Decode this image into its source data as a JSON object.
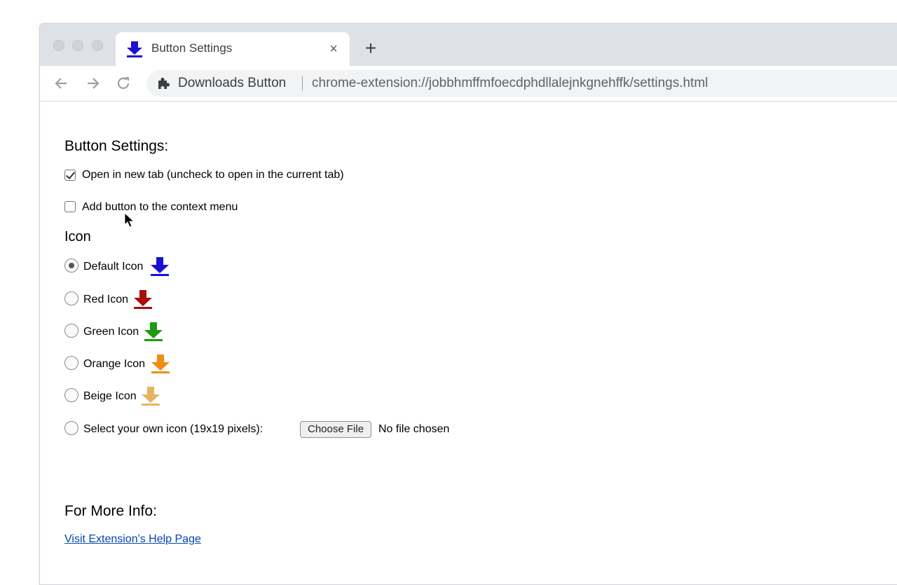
{
  "browser": {
    "tab": {
      "title": "Button Settings",
      "close_glyph": "×",
      "favicon": "download-arrow-icon"
    },
    "new_tab_glyph": "+",
    "omnibox": {
      "site_name": "Downloads Button",
      "url": "chrome-extension://jobbhmffmfoecdphdllalejnkgnehffk/settings.html"
    }
  },
  "settings": {
    "heading": "Button Settings:",
    "open_new_tab": {
      "label": "Open in new tab (uncheck to open in the current tab)",
      "checked": true
    },
    "context_menu": {
      "label": "Add button to the context menu",
      "checked": false
    }
  },
  "icon_section": {
    "heading": "Icon",
    "options": [
      {
        "label": "Default Icon",
        "color": "#1a0fd6",
        "checked": true
      },
      {
        "label": "Red Icon",
        "color": "#a80d0d",
        "checked": false
      },
      {
        "label": "Green Icon",
        "color": "#1f9a10",
        "checked": false
      },
      {
        "label": "Orange Icon",
        "color": "#f28c10",
        "checked": false
      },
      {
        "label": "Beige Icon",
        "color": "#e6b365",
        "checked": false
      }
    ],
    "custom": {
      "label": "Select your own icon (19x19 pixels):",
      "button": "Choose File",
      "status": "No file chosen"
    }
  },
  "more_info": {
    "heading": "For More Info:",
    "link": "Visit Extension's Help Page"
  }
}
